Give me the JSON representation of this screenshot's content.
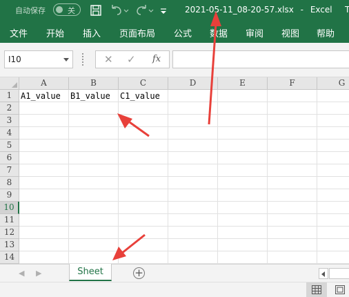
{
  "titlebar": {
    "autosave_label": "自动保存",
    "autosave_state": "关",
    "filename": "2021-05-11_08-20-57.xlsx",
    "separator": "-",
    "app_name": "Excel",
    "overflow_text": "T"
  },
  "ribbon": {
    "tabs": [
      "文件",
      "开始",
      "插入",
      "页面布局",
      "公式",
      "数据",
      "审阅",
      "视图",
      "帮助"
    ]
  },
  "formula_bar": {
    "name_box_value": "I10",
    "cancel_symbol": "✕",
    "enter_symbol": "✓",
    "fx_label": "fx",
    "formula_value": ""
  },
  "grid": {
    "columns": [
      "A",
      "B",
      "C",
      "D",
      "E",
      "F",
      "G"
    ],
    "rows": [
      "1",
      "2",
      "3",
      "4",
      "5",
      "6",
      "7",
      "8",
      "9",
      "10",
      "11",
      "12",
      "13",
      "14"
    ],
    "active_row": "10",
    "cells": {
      "A1": "A1_value",
      "B1": "B1_value",
      "C1": "C1_value"
    }
  },
  "sheets": {
    "tabs": [
      "Sheet"
    ],
    "active": "Sheet",
    "add_symbol": "+",
    "prev_symbol": "◀",
    "next_symbol": "▶"
  },
  "statusbar": {
    "views": [
      "normal-view-icon",
      "page-layout-view-icon"
    ]
  },
  "colors": {
    "excel_green": "#217346",
    "annotation_red": "#e8403a"
  }
}
